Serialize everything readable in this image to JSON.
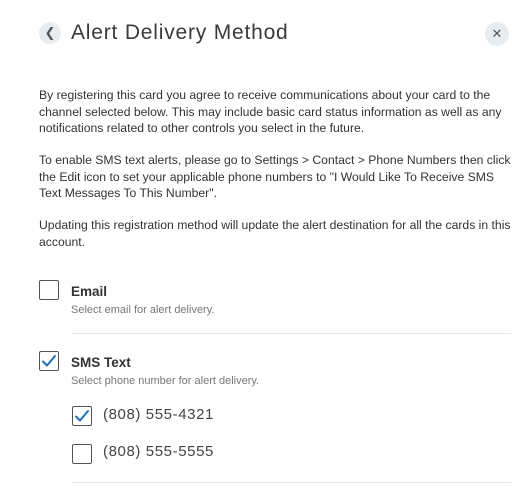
{
  "header": {
    "back_icon": "chevron-left-icon",
    "title": "Alert Delivery Method",
    "close_icon": "close-icon"
  },
  "paragraphs": {
    "p1": "By registering this card you agree to receive communications about your card to the channel selected below. This may include basic card status information as well as any notifications related to other controls you select in the future.",
    "p2": "To enable SMS text alerts, please go to Settings > Contact > Phone Numbers then click the Edit icon to set your applicable phone numbers to \"I Would Like To Receive SMS Text Messages To This Number\".",
    "p3": "Updating this registration method will update the alert destination for all the cards in this account."
  },
  "options": {
    "email": {
      "label": "Email",
      "description": "Select email for alert delivery.",
      "checked": false
    },
    "sms": {
      "label": "SMS Text",
      "description": "Select phone number for alert delivery.",
      "checked": true
    }
  },
  "phones": [
    {
      "number": "(808) 555-4321",
      "checked": true
    },
    {
      "number": "(808) 555-5555",
      "checked": false
    }
  ],
  "colors": {
    "accent": "#1f6fb5",
    "icon_bg": "#e9ecef",
    "divider": "#e6e6e6"
  }
}
